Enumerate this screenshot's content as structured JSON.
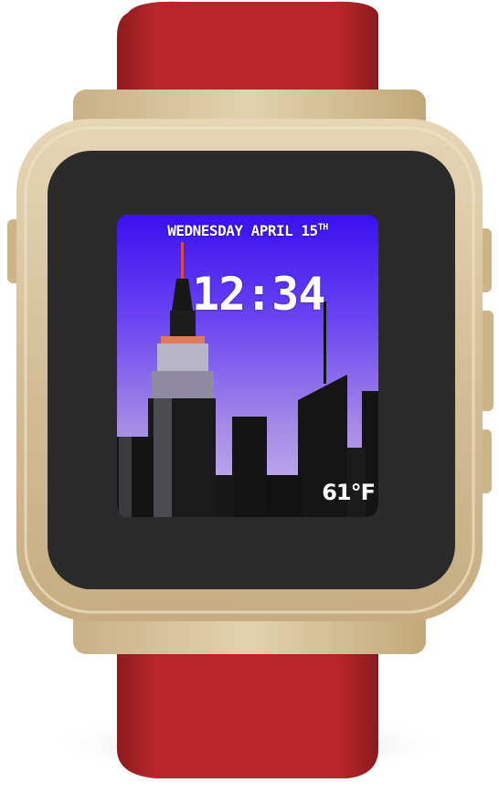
{
  "device": {
    "strap_color": "#b5262a",
    "case_color": "#d8c39d",
    "bezel_color": "#2b2b2b"
  },
  "watchface": {
    "weekday": "WEDNESDAY",
    "month": "APRIL",
    "day": "15",
    "day_suffix": "TH",
    "time": "12:34",
    "temperature": "61°F",
    "background_scene": "city-skyline-night-icon"
  }
}
